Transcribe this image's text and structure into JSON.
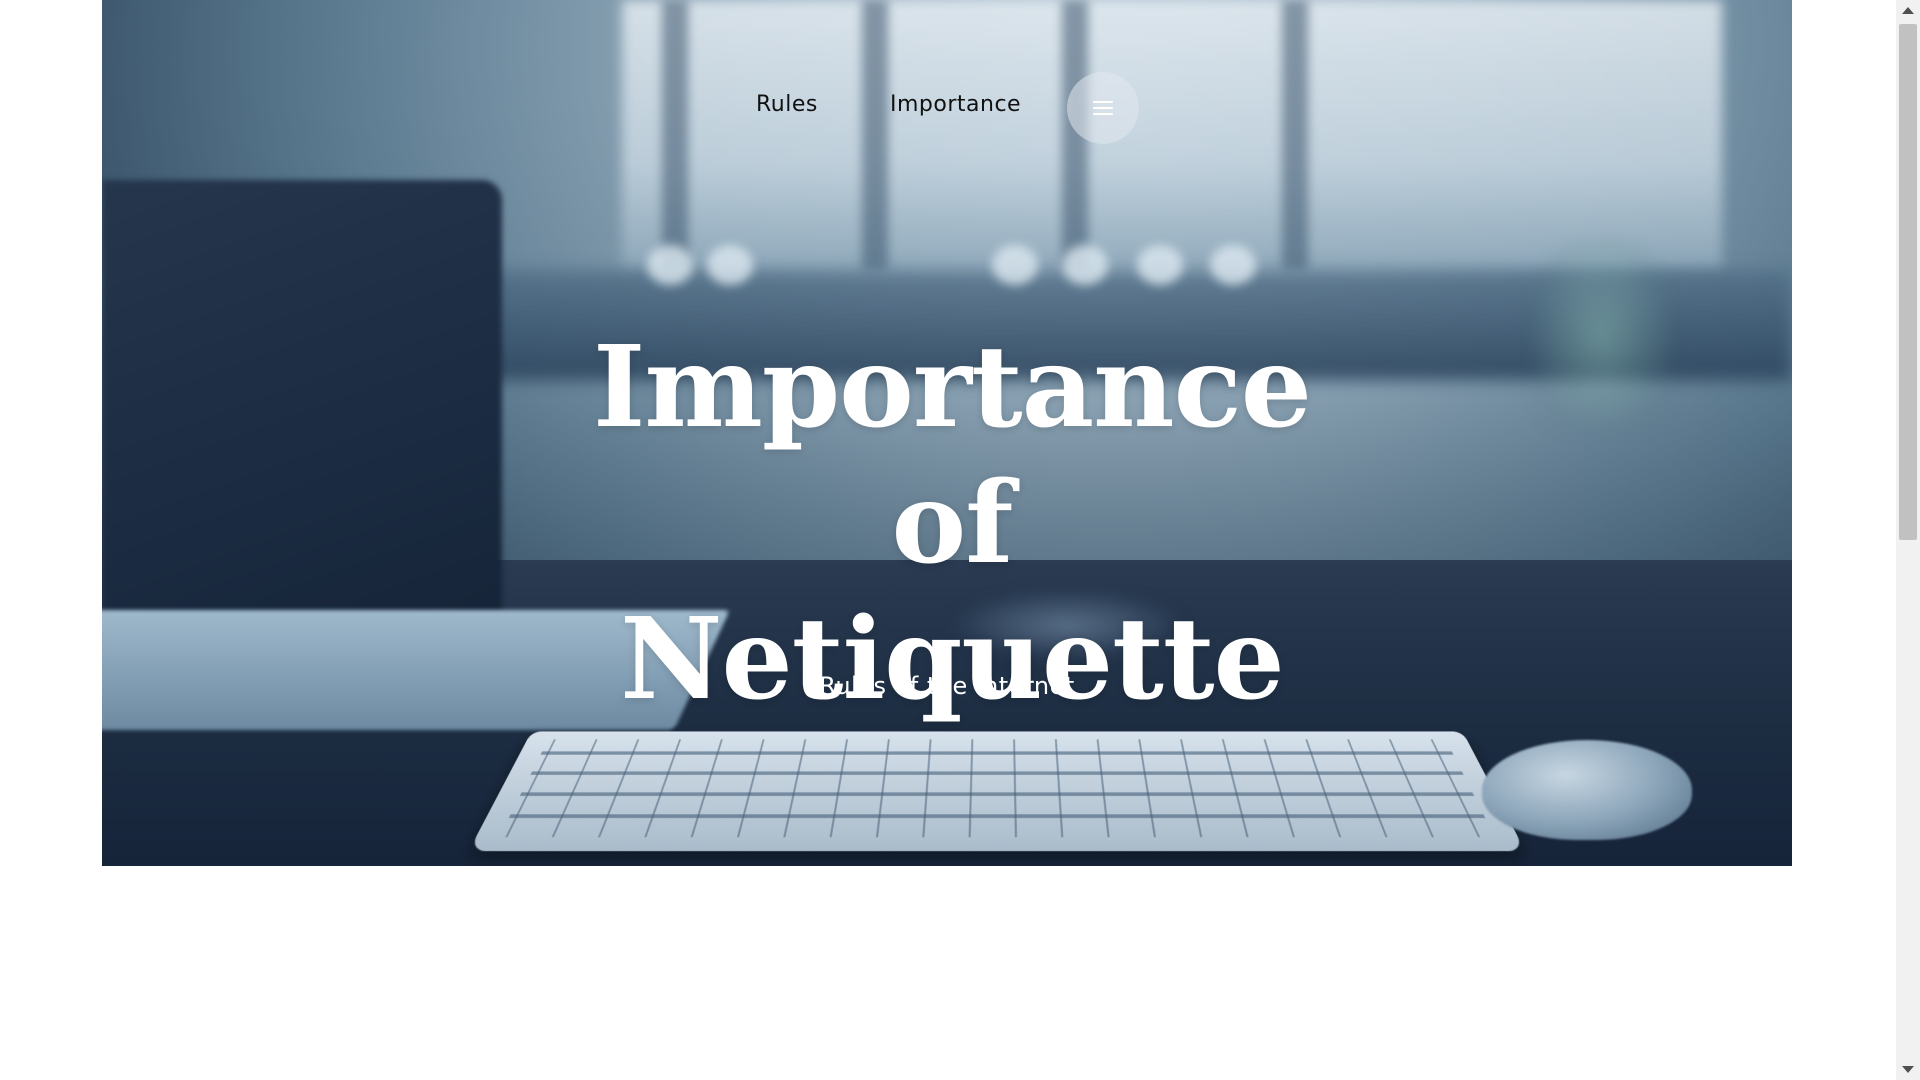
{
  "nav": {
    "rules_label": "Rules",
    "importance_label": "Importance",
    "menu_icon": "hamburger-menu-icon"
  },
  "hero": {
    "title_line1": "Importance of",
    "title_line2": "Netiquette",
    "subtitle": "Rules of the internet",
    "background_description_icon": "desk-keyboard-photo"
  },
  "colors": {
    "page_background": "#ffffff",
    "hero_overlay": "#263d54",
    "title_text": "#ffffff",
    "nav_text": "#111111",
    "scrollbar_thumb": "#c1c1c1"
  }
}
